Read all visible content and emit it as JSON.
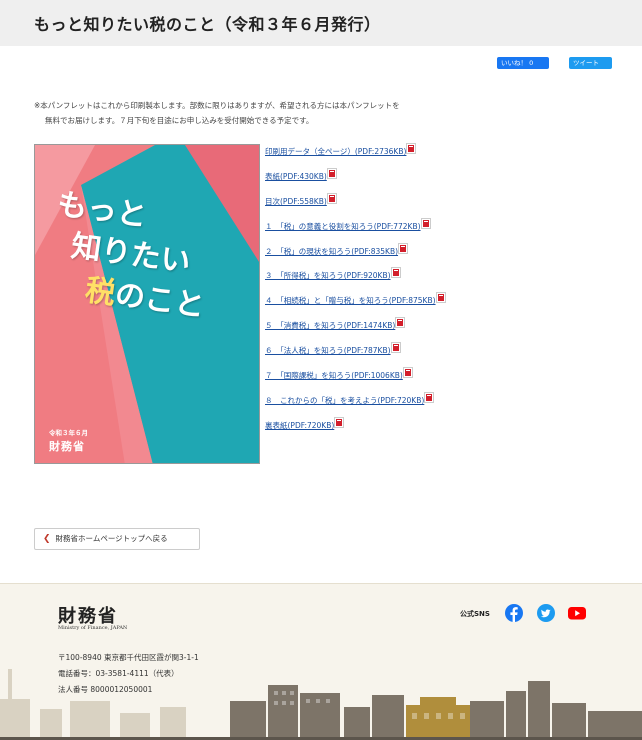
{
  "page": {
    "title": "もっと知りたい税のこと（令和３年６月発行）"
  },
  "share": {
    "like_label": "いいね！ 0",
    "tweet_label": "ツイート"
  },
  "notice": {
    "line1": "※本パンフレットはこれから印刷製本します。部数に限りはありますが、希望される方には本パンフレットを",
    "line2": "無料でお届けします。７月下旬を目途にお申し込みを受付開始できる予定です。"
  },
  "cover": {
    "line1": "もっと",
    "line2": "知りたい",
    "line3_highlight": "税",
    "line3_rest": "のこと",
    "date": "令和３年６月",
    "org": "財務省"
  },
  "pdf_links": [
    {
      "label": "印刷用データ（全ページ）(PDF:2736KB)"
    },
    {
      "label": "表紙(PDF:430KB)"
    },
    {
      "label": "目次(PDF:558KB)"
    },
    {
      "label": "１　「税」の意義と役割を知ろう(PDF:772KB)"
    },
    {
      "label": "２　「税」の現状を知ろう(PDF:835KB)"
    },
    {
      "label": "３　「所得税」を知ろう(PDF:920KB)"
    },
    {
      "label": "４　「相続税」と「贈与税」を知ろう(PDF:875KB)"
    },
    {
      "label": "５　「消費税」を知ろう(PDF:1474KB)"
    },
    {
      "label": "６　「法人税」を知ろう(PDF:787KB)"
    },
    {
      "label": "７　「国際課税」を知ろう(PDF:1006KB)"
    },
    {
      "label": "８　これからの「税」を考えよう(PDF:720KB)"
    },
    {
      "label": "裏表紙(PDF:720KB)"
    }
  ],
  "back_button": {
    "label": "財務省ホームページトップへ戻る"
  },
  "footer": {
    "logo": "財務省",
    "logo_en": "Ministry of Finance, JAPAN",
    "address": "〒100-8940 東京都千代田区霞が関3-1-1",
    "phone": "電話番号：03-3581-4111（代表）",
    "corp_no": "法人番号 8000012050001",
    "sns_label": "公式SNS"
  },
  "colors": {
    "link": "#1a4fa0",
    "pdf_icon": "#d31f2b",
    "cover_pink": "#f07c82",
    "cover_teal": "#1fa7b3",
    "facebook": "#1877f2",
    "twitter": "#1d9bf0",
    "youtube": "#ff0000"
  }
}
